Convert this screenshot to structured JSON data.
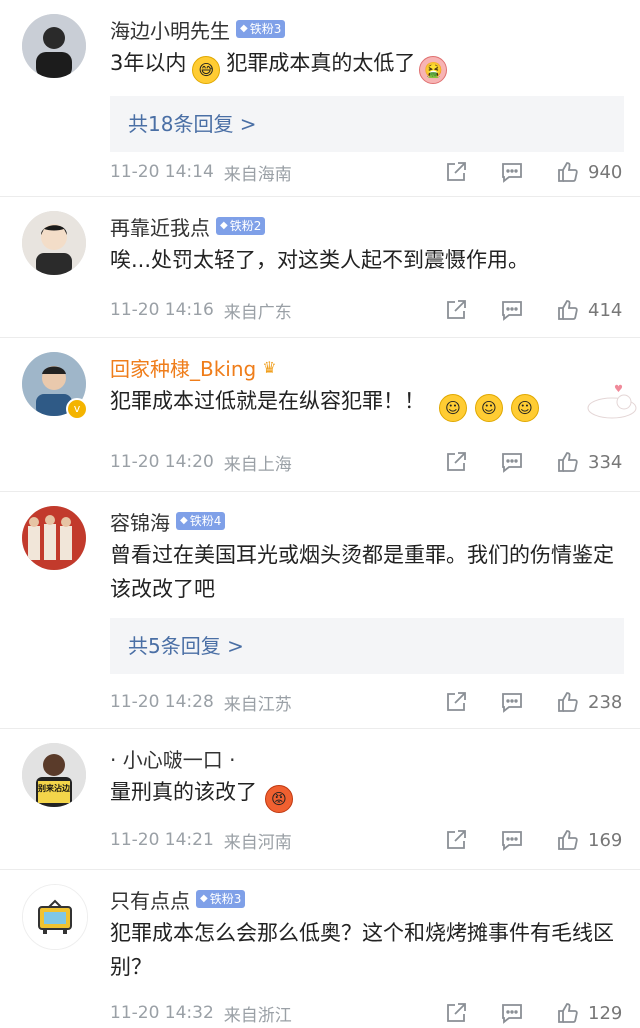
{
  "comments": [
    {
      "username": "海边小明先生",
      "badge": "铁粉3",
      "text": "3年以内",
      "text_after": "犯罪成本真的太低了",
      "replies": "共18条回复 >",
      "time": "11-20 14:14",
      "location": "来自海南",
      "likes": "940"
    },
    {
      "username": "再靠近我点",
      "badge": "铁粉2",
      "text": "唉...处罚太轻了，对这类人起不到震慑作用。",
      "time": "11-20 14:16",
      "location": "来自广东",
      "likes": "414"
    },
    {
      "username": "回家种棣_Bking",
      "text": "犯罪成本过低就是在纵容犯罪！！",
      "time": "11-20 14:20",
      "location": "来自上海",
      "likes": "334"
    },
    {
      "username": "容锦海",
      "badge": "铁粉4",
      "text": "曾看过在美国耳光或烟头烫都是重罪。我们的伤情鉴定该改改了吧",
      "replies": "共5条回复 >",
      "time": "11-20 14:28",
      "location": "来自江苏",
      "likes": "238"
    },
    {
      "username": "· 小心啵一口 ·",
      "text": "量刑真的该改了",
      "time": "11-20 14:21",
      "location": "来自河南",
      "likes": "169",
      "avatar_text": "别来沾边"
    },
    {
      "username": "只有点点",
      "badge": "铁粉3",
      "text": "犯罪成本怎么会那么低奥？这个和烧烤摊事件有毛线区别？",
      "time": "11-20 14:32",
      "location": "来自浙江",
      "likes": "129"
    }
  ],
  "colors": {
    "vip_name": "#ef7d1a",
    "badge_bg": "#7fa0e8",
    "reply_link": "#4a6fa5",
    "meta": "#9aa0a6"
  },
  "icons": {
    "share": "share-icon",
    "comment": "comment-icon",
    "like": "like-icon"
  }
}
